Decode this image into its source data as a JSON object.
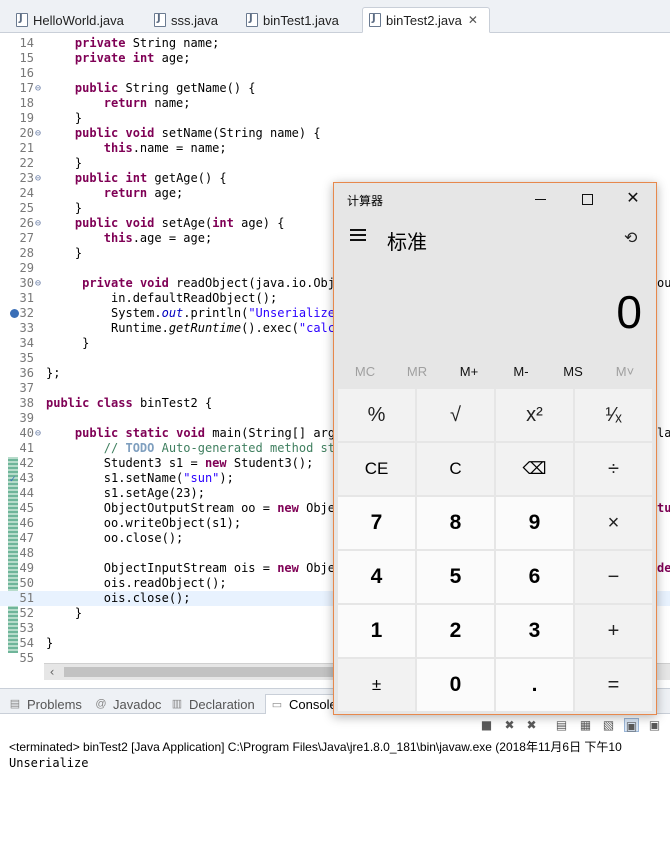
{
  "editor_tabs": [
    {
      "label": "HelloWorld.java"
    },
    {
      "label": "sss.java"
    },
    {
      "label": "binTest1.java"
    },
    {
      "label": "binTest2.java",
      "active": true,
      "close": "✕"
    }
  ],
  "code_lines": [
    {
      "n": "14",
      "code": "    private String name;"
    },
    {
      "n": "15",
      "code": "    private int age;"
    },
    {
      "n": "16",
      "code": ""
    },
    {
      "n": "17",
      "code": "    public String getName() {"
    },
    {
      "n": "18",
      "code": "        return name;"
    },
    {
      "n": "19",
      "code": "    }"
    },
    {
      "n": "20",
      "code": "    public void setName(String name) {"
    },
    {
      "n": "21",
      "code": "        this.name = name;"
    },
    {
      "n": "22",
      "code": "    }"
    },
    {
      "n": "23",
      "code": "    public int getAge() {"
    },
    {
      "n": "24",
      "code": "        return age;"
    },
    {
      "n": "25",
      "code": "    }"
    },
    {
      "n": "26",
      "code": "    public void setAge(int age) {"
    },
    {
      "n": "27",
      "code": "        this.age = age;"
    },
    {
      "n": "28",
      "code": "    }"
    },
    {
      "n": "29",
      "code": ""
    },
    {
      "n": "30",
      "code": "     private void readObject(java.io.Obje"
    },
    {
      "n": "31",
      "code": "         in.defaultReadObject();"
    },
    {
      "n": "32",
      "code": "         System.out.println(\"Unserialize\""
    },
    {
      "n": "33",
      "code": "         Runtime.getRuntime().exec(\"calc."
    },
    {
      "n": "34",
      "code": "     }"
    },
    {
      "n": "35",
      "code": ""
    },
    {
      "n": "36",
      "code": "};"
    },
    {
      "n": "37",
      "code": ""
    },
    {
      "n": "38",
      "code": "public class binTest2 {"
    },
    {
      "n": "39",
      "code": ""
    },
    {
      "n": "40",
      "code": "    public static void main(String[] args"
    },
    {
      "n": "41",
      "code": "        // TODO Auto-generated method stu"
    },
    {
      "n": "42",
      "code": "        Student3 s1 = new Student3();"
    },
    {
      "n": "43",
      "code": "        s1.setName(\"sun\");"
    },
    {
      "n": "44",
      "code": "        s1.setAge(23);"
    },
    {
      "n": "45",
      "code": "        ObjectOutputStream oo = new Object"
    },
    {
      "n": "46",
      "code": "        oo.writeObject(s1);"
    },
    {
      "n": "47",
      "code": "        oo.close();"
    },
    {
      "n": "48",
      "code": ""
    },
    {
      "n": "49",
      "code": "        ObjectInputStream ois = new Object"
    },
    {
      "n": "50",
      "code": "        ois.readObject();"
    },
    {
      "n": "51",
      "code": "        ois.close();"
    },
    {
      "n": "52",
      "code": "    }"
    },
    {
      "n": "53",
      "code": ""
    },
    {
      "n": "54",
      "code": "}"
    },
    {
      "n": "55",
      "code": ""
    }
  ],
  "right_edge_fragments": {
    "line30": "ou",
    "line40": "la",
    "line45": "tu",
    "line49": "de"
  },
  "bottom_tabs": {
    "problems": "Problems",
    "javadoc": "Javadoc",
    "declaration": "Declaration",
    "console": "Console"
  },
  "console": {
    "terminated": "<terminated> binTest2 [Java Application] C:\\Program Files\\Java\\jre1.8.0_181\\bin\\javaw.exe (2018年11月6日 下午10",
    "output": "Unserialize"
  },
  "calculator": {
    "title": "计算器",
    "mode": "标准",
    "display": "0",
    "memory": [
      {
        "label": "MC",
        "enabled": false
      },
      {
        "label": "MR",
        "enabled": false
      },
      {
        "label": "M+",
        "enabled": true
      },
      {
        "label": "M-",
        "enabled": true
      },
      {
        "label": "MS",
        "enabled": true
      },
      {
        "label": "M˅",
        "enabled": false
      }
    ],
    "keys": [
      {
        "label": "%",
        "kind": "op"
      },
      {
        "label": "√",
        "kind": "op"
      },
      {
        "label": "x²",
        "kind": "op"
      },
      {
        "label": "¹⁄ₓ",
        "kind": "op"
      },
      {
        "label": "CE",
        "kind": "fn"
      },
      {
        "label": "C",
        "kind": "fn"
      },
      {
        "label": "⌫",
        "kind": "fn"
      },
      {
        "label": "÷",
        "kind": "op"
      },
      {
        "label": "7",
        "kind": "num"
      },
      {
        "label": "8",
        "kind": "num"
      },
      {
        "label": "9",
        "kind": "num"
      },
      {
        "label": "×",
        "kind": "op"
      },
      {
        "label": "4",
        "kind": "num"
      },
      {
        "label": "5",
        "kind": "num"
      },
      {
        "label": "6",
        "kind": "num"
      },
      {
        "label": "−",
        "kind": "op"
      },
      {
        "label": "1",
        "kind": "num"
      },
      {
        "label": "2",
        "kind": "num"
      },
      {
        "label": "3",
        "kind": "num"
      },
      {
        "label": "+",
        "kind": "op"
      },
      {
        "label": "±",
        "kind": "fn"
      },
      {
        "label": "0",
        "kind": "num"
      },
      {
        "label": ".",
        "kind": "num"
      },
      {
        "label": "=",
        "kind": "op"
      }
    ]
  }
}
